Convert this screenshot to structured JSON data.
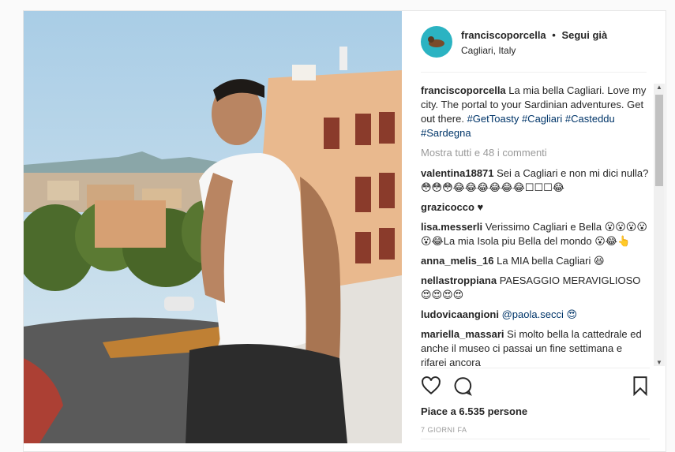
{
  "post": {
    "username": "franciscoporcella",
    "separator": "•",
    "follow_label": "Segui già",
    "location": "Cagliari, Italy",
    "caption": {
      "user": "franciscoporcella",
      "text": "La mia bella Cagliari. Love my city. The portal to your Sardinian adventures. Get out there.",
      "hashtags": [
        "#GetToasty",
        "#Cagliari",
        "#Casteddu",
        "#Sardegna"
      ]
    },
    "more_comments": "Mostra tutti e 48 i commenti",
    "comments": [
      {
        "user": "valentina18871",
        "text": "Sei a Cagliari e non mi dici nulla?😳😳😳😂😂😂😂😂😂☐☐☐😂"
      },
      {
        "user": "grazicocco",
        "text": "♥"
      },
      {
        "user": "lisa.messerli",
        "text": "Verissimo Cagliari e Bella 😮😮😮😮😮😂La mia Isola piu Bella del mondo 😮😂👆"
      },
      {
        "user": "anna_melis_16",
        "text": "La MIA bella Cagliari 😆"
      },
      {
        "user": "nellastroppiana",
        "text": "PAESAGGIO MERAVIGLIOSO 😍😍😍😍"
      },
      {
        "user": "ludovicaangioni",
        "text": "@paola.secci 😍"
      },
      {
        "user": "mariella_massari",
        "text": "Si molto bella la cattedrale ed anche il museo ci passai un fine settimana e rifarei ancora"
      }
    ],
    "likes": "Piace a 6.535 persone",
    "time": "7 GIORNI FA",
    "colors": {
      "link": "#003569",
      "muted": "#999999",
      "text": "#262626"
    }
  },
  "icons": {
    "like": "heart-icon",
    "comment": "comment-icon",
    "save": "bookmark-icon"
  }
}
